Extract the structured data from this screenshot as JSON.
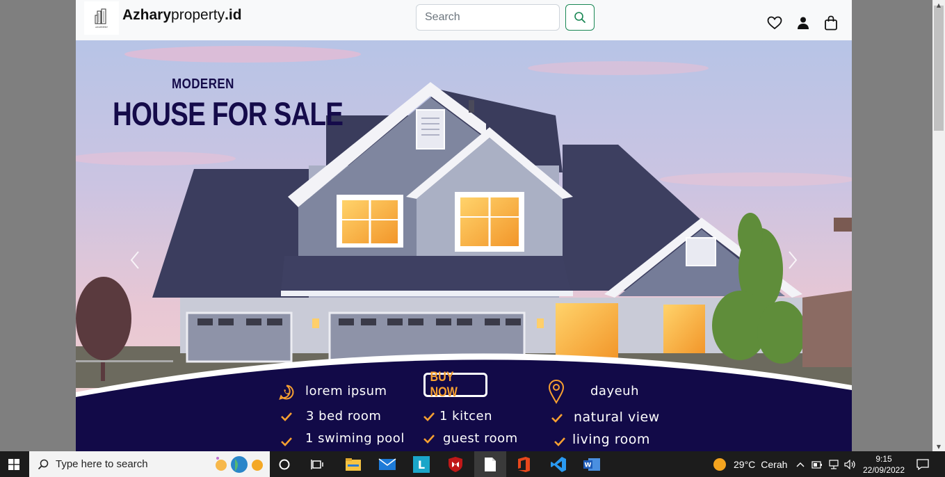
{
  "navbar": {
    "brand_bold": "Azhary",
    "brand_light": "property",
    "brand_suffix": ".id",
    "logo_text": "APARTMENT",
    "search": {
      "placeholder": "Search"
    }
  },
  "hero": {
    "subtitle": "MODEREN",
    "title_part1": "HOUSE FOR",
    "title_part2": "SALE",
    "contact": "lorem ipsum",
    "location": "dayeuh",
    "buy_label": "BUY NOW",
    "features_col1": [
      "3 bed room",
      "1 swiming pool"
    ],
    "features_col2": [
      "1 kitcen",
      "guest room"
    ],
    "features_col3": [
      "natural view",
      "living room"
    ]
  },
  "colors": {
    "navy": "#120a48",
    "accent": "#f7a031",
    "search_button": "#198754"
  },
  "taskbar": {
    "search_placeholder": "Type here to search",
    "temperature": "29°C",
    "weather": "Cerah",
    "time": "9:15",
    "date": "22/09/2022"
  }
}
